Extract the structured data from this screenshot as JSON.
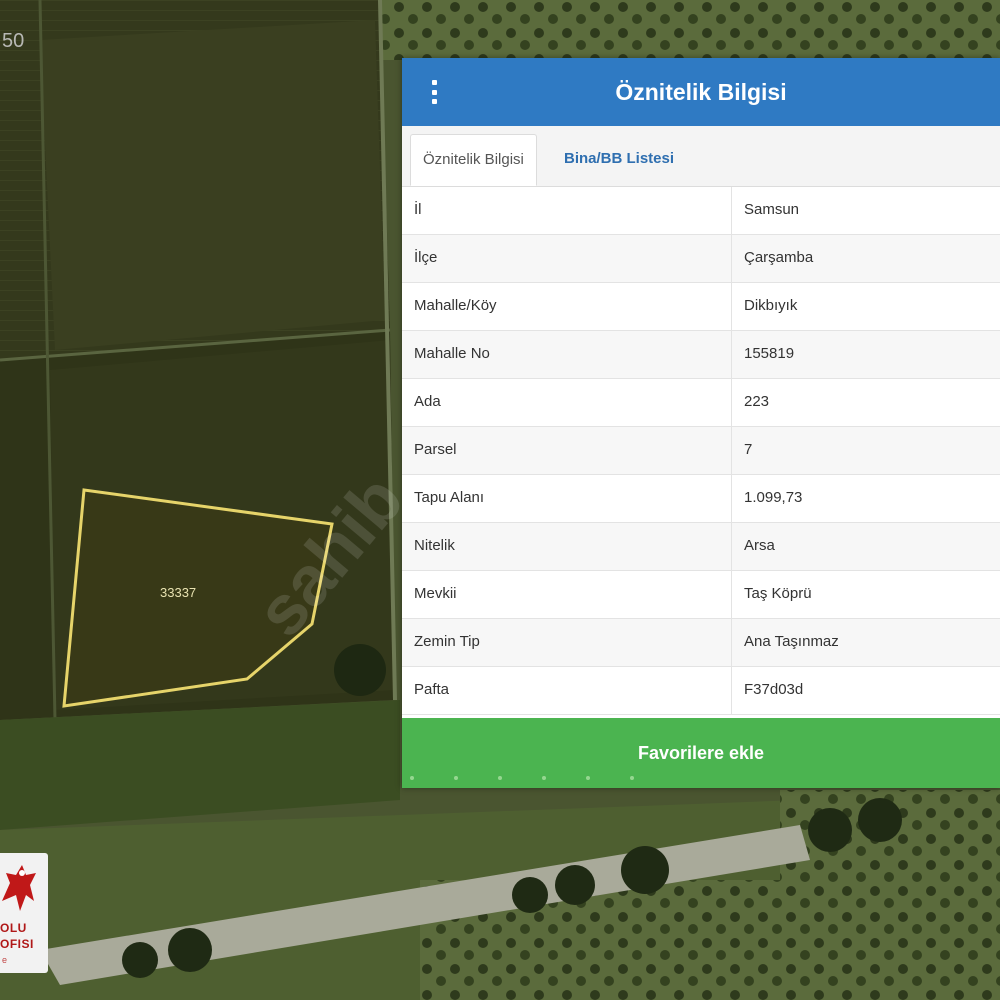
{
  "map": {
    "scale_text": "50",
    "parcel_label": "33337",
    "watermark": "sahib"
  },
  "logo": {
    "line1": "OLU",
    "line2": "OFISI",
    "line3": "e"
  },
  "panel": {
    "title": "Öznitelik Bilgisi",
    "tabs": [
      {
        "label": "Öznitelik Bilgisi",
        "active": true
      },
      {
        "label": "Bina/BB Listesi",
        "active": false
      }
    ],
    "rows": [
      {
        "key": "İl",
        "value": "Samsun"
      },
      {
        "key": "İlçe",
        "value": "Çarşamba"
      },
      {
        "key": "Mahalle/Köy",
        "value": "Dikbıyık"
      },
      {
        "key": "Mahalle No",
        "value": "155819"
      },
      {
        "key": "Ada",
        "value": "223"
      },
      {
        "key": "Parsel",
        "value": "7"
      },
      {
        "key": "Tapu Alanı",
        "value": "1.099,73"
      },
      {
        "key": "Nitelik",
        "value": "Arsa"
      },
      {
        "key": "Mevkii",
        "value": "Taş Köprü"
      },
      {
        "key": "Zemin Tip",
        "value": "Ana Taşınmaz"
      },
      {
        "key": "Pafta",
        "value": "F37d03d"
      }
    ],
    "favorite_button": "Favorilere ekle"
  },
  "colors": {
    "header": "#2f7ac3",
    "favorite": "#4bb450",
    "tab_link": "#2f6fb0",
    "parcel_outline": "#e6d46a"
  }
}
